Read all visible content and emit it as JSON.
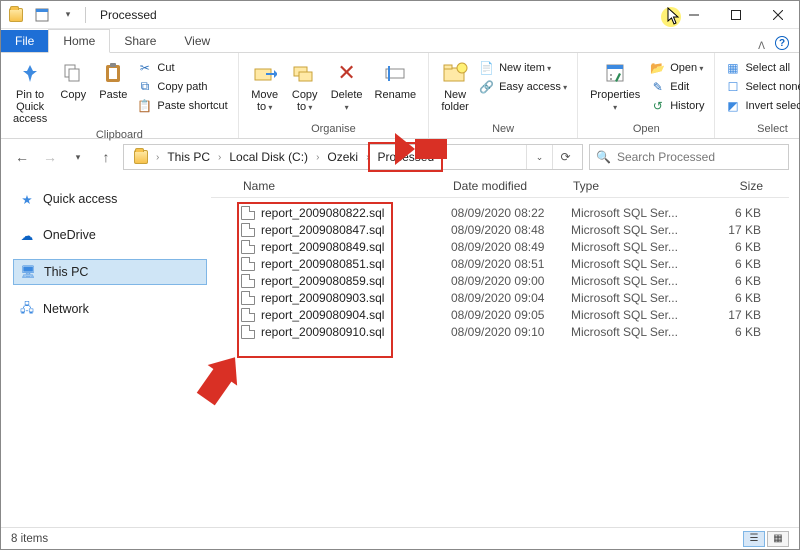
{
  "window": {
    "title": "Processed"
  },
  "tabs": {
    "file": "File",
    "home": "Home",
    "share": "Share",
    "view": "View"
  },
  "ribbon": {
    "clipboard": {
      "label": "Clipboard",
      "pin": "Pin to Quick\naccess",
      "copy": "Copy",
      "paste": "Paste",
      "cut": "Cut",
      "copy_path": "Copy path",
      "paste_shortcut": "Paste shortcut"
    },
    "organise": {
      "label": "Organise",
      "move_to": "Move\nto",
      "copy_to": "Copy\nto",
      "delete": "Delete",
      "rename": "Rename"
    },
    "new_group": {
      "label": "New",
      "new_folder": "New\nfolder",
      "new_item": "New item",
      "easy_access": "Easy access"
    },
    "open_group": {
      "label": "Open",
      "properties": "Properties",
      "open": "Open",
      "edit": "Edit",
      "history": "History"
    },
    "select": {
      "label": "Select",
      "select_all": "Select all",
      "select_none": "Select none",
      "invert": "Invert selection"
    }
  },
  "breadcrumbs": [
    "This PC",
    "Local Disk (C:)",
    "Ozeki",
    "Processed"
  ],
  "search": {
    "placeholder": "Search Processed"
  },
  "sidebar": {
    "quick_access": "Quick access",
    "onedrive": "OneDrive",
    "this_pc": "This PC",
    "network": "Network"
  },
  "columns": {
    "name": "Name",
    "date": "Date modified",
    "type": "Type",
    "size": "Size"
  },
  "files": [
    {
      "name": "report_2009080822.sql",
      "date": "08/09/2020 08:22",
      "type": "Microsoft SQL Ser...",
      "size": "6 KB"
    },
    {
      "name": "report_2009080847.sql",
      "date": "08/09/2020 08:48",
      "type": "Microsoft SQL Ser...",
      "size": "17 KB"
    },
    {
      "name": "report_2009080849.sql",
      "date": "08/09/2020 08:49",
      "type": "Microsoft SQL Ser...",
      "size": "6 KB"
    },
    {
      "name": "report_2009080851.sql",
      "date": "08/09/2020 08:51",
      "type": "Microsoft SQL Ser...",
      "size": "6 KB"
    },
    {
      "name": "report_2009080859.sql",
      "date": "08/09/2020 09:00",
      "type": "Microsoft SQL Ser...",
      "size": "6 KB"
    },
    {
      "name": "report_2009080903.sql",
      "date": "08/09/2020 09:04",
      "type": "Microsoft SQL Ser...",
      "size": "6 KB"
    },
    {
      "name": "report_2009080904.sql",
      "date": "08/09/2020 09:05",
      "type": "Microsoft SQL Ser...",
      "size": "17 KB"
    },
    {
      "name": "report_2009080910.sql",
      "date": "08/09/2020 09:10",
      "type": "Microsoft SQL Ser...",
      "size": "6 KB"
    }
  ],
  "status": {
    "count": "8 items"
  }
}
